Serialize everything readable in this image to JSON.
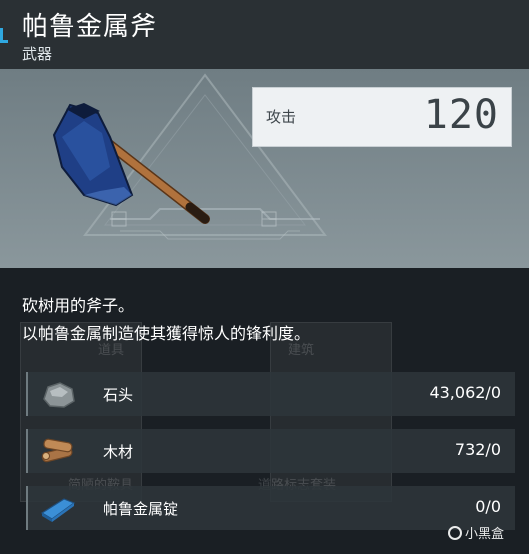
{
  "item": {
    "title": "帕鲁金属斧",
    "category": "武器"
  },
  "stat": {
    "label": "攻击",
    "value": "120"
  },
  "description": {
    "line1": "砍树用的斧子。",
    "line2": "以帕鲁金属制造使其獲得惊人的锋利度。"
  },
  "background_labels": {
    "card1_top": "道具",
    "card2_top": "建筑",
    "card1_bottom": "简陋的鞍具",
    "card2_bottom": "道路标志套装"
  },
  "materials": [
    {
      "name": "石头",
      "count": "43,062/0",
      "icon": "stone-icon"
    },
    {
      "name": "木材",
      "count": "732/0",
      "icon": "wood-icon"
    },
    {
      "name": "帕鲁金属锭",
      "count": "0/0",
      "icon": "pal-metal-ingot-icon"
    }
  ],
  "watermark": "小黑盒",
  "colors": {
    "accent": "#2fa8e0",
    "showcase_bg": "#78868c",
    "axe_head": "#1f3f86",
    "handle": "#b0723d"
  }
}
